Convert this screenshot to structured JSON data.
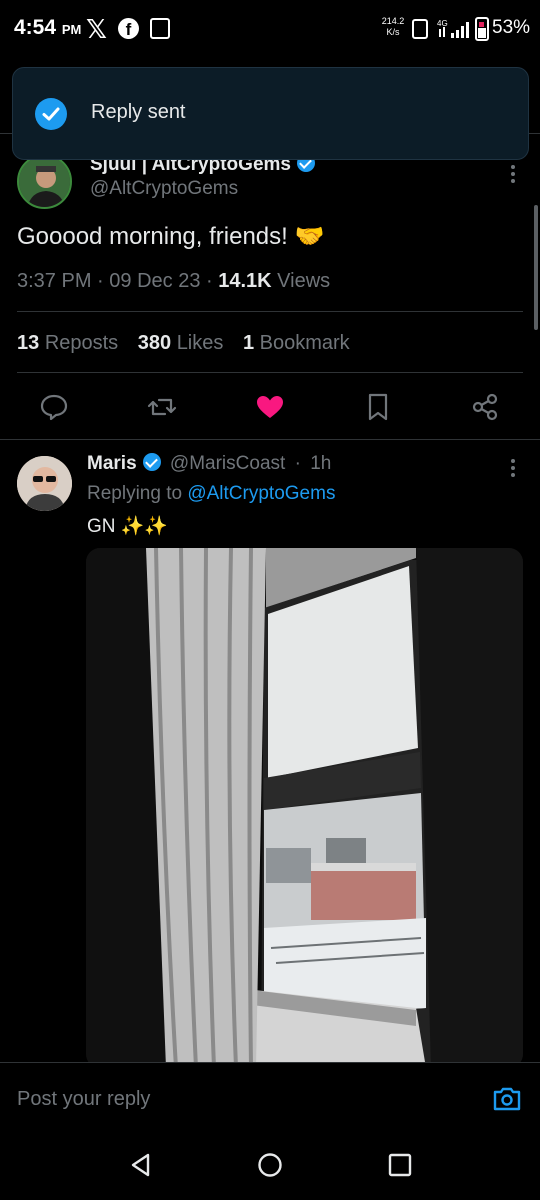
{
  "status_bar": {
    "time": "4:54",
    "ampm": "PM",
    "x_logo": "𝕏",
    "fb_logo": "f",
    "net_speed_value": "214.2",
    "net_speed_unit": "K/s",
    "net_type": "4G",
    "battery": "53%"
  },
  "toast": {
    "text": "Reply sent"
  },
  "tweet": {
    "author_name": "Sjuul | AltCryptoGems",
    "author_handle": "@AltCryptoGems",
    "text": "Gooood morning, friends! 🤝",
    "time": "3:37 PM",
    "date": "09 Dec 23",
    "views_count": "14.1K",
    "views_label": "Views",
    "reposts_count": "13",
    "reposts_label": "Reposts",
    "likes_count": "380",
    "likes_label": "Likes",
    "bookmarks_count": "1",
    "bookmarks_label": "Bookmark"
  },
  "reply": {
    "author_name": "Maris",
    "author_handle": "@MarisCoast",
    "age": "1h",
    "replying_prefix": "Replying to",
    "replying_to": "@AltCryptoGems",
    "text": "GN ✨✨"
  },
  "compose": {
    "placeholder": "Post your reply"
  },
  "colors": {
    "accent": "#1d9bf0",
    "like": "#f91880",
    "muted": "#71767b",
    "toast_bg": "#0c1c27"
  }
}
